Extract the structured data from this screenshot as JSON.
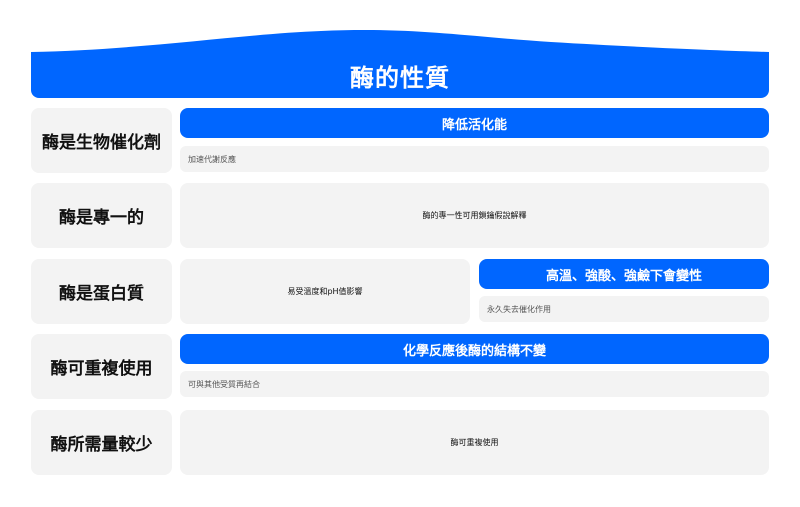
{
  "title": "酶的性質",
  "colors": {
    "accent": "#0066ff",
    "panel": "#f3f3f3"
  },
  "rows": [
    {
      "label": "酶是生物催化劑",
      "highlight": "降低活化能",
      "detail": "加速代謝反應"
    },
    {
      "label": "酶是專一的",
      "content": "酶的專一性可用鎖鑰假說解釋"
    },
    {
      "label": "酶是蛋白質",
      "content": "易受溫度和pH值影響",
      "highlight": "高溫、強酸、強鹼下會變性",
      "detail": "永久失去催化作用"
    },
    {
      "label": "酶可重複使用",
      "highlight": "化學反應後酶的結構不變",
      "detail": "可與其他受質再結合"
    },
    {
      "label": "酶所需量較少",
      "content": "酶可重複使用"
    }
  ]
}
